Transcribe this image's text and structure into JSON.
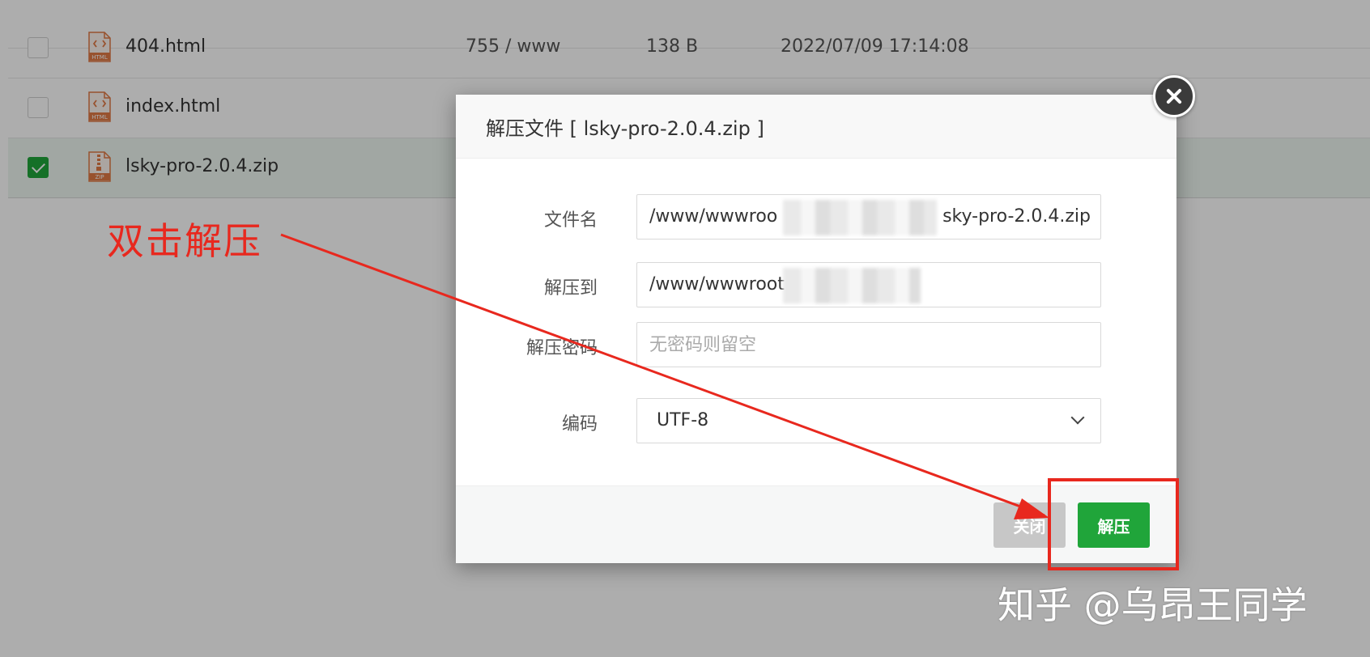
{
  "file_list": [
    {
      "name": "404.html",
      "type": "html",
      "perm": "755 / www",
      "size": "138 B",
      "mtime": "2022/07/09 17:14:08",
      "checked": false
    },
    {
      "name": "index.html",
      "type": "html",
      "perm": "",
      "size": "",
      "mtime": "",
      "checked": false
    },
    {
      "name": "lsky-pro-2.0.4.zip",
      "type": "zip",
      "perm": "",
      "size": "",
      "mtime": "",
      "checked": true
    }
  ],
  "icons": {
    "html": "HTML",
    "zip": "ZIP"
  },
  "annotation": {
    "text": "双击解压",
    "color": "#e8281e"
  },
  "dialog": {
    "title": "解压文件 [ lsky-pro-2.0.4.zip ]",
    "filename": {
      "label": "文件名",
      "value_left": "/www/wwwroo",
      "value_right": "sky-pro-2.0.4.zip"
    },
    "extract_to": {
      "label": "解压到",
      "value": "/www/wwwroot"
    },
    "password": {
      "label": "解压密码",
      "placeholder": "无密码则留空"
    },
    "encoding": {
      "label": "编码",
      "value": "UTF-8"
    },
    "buttons": {
      "close": "关闭",
      "extract": "解压"
    }
  },
  "watermark": "知乎 @乌昂王同学",
  "colors": {
    "accent": "#20a53a",
    "annotation": "#e8281e",
    "button_disabled": "#c7c7c7"
  }
}
